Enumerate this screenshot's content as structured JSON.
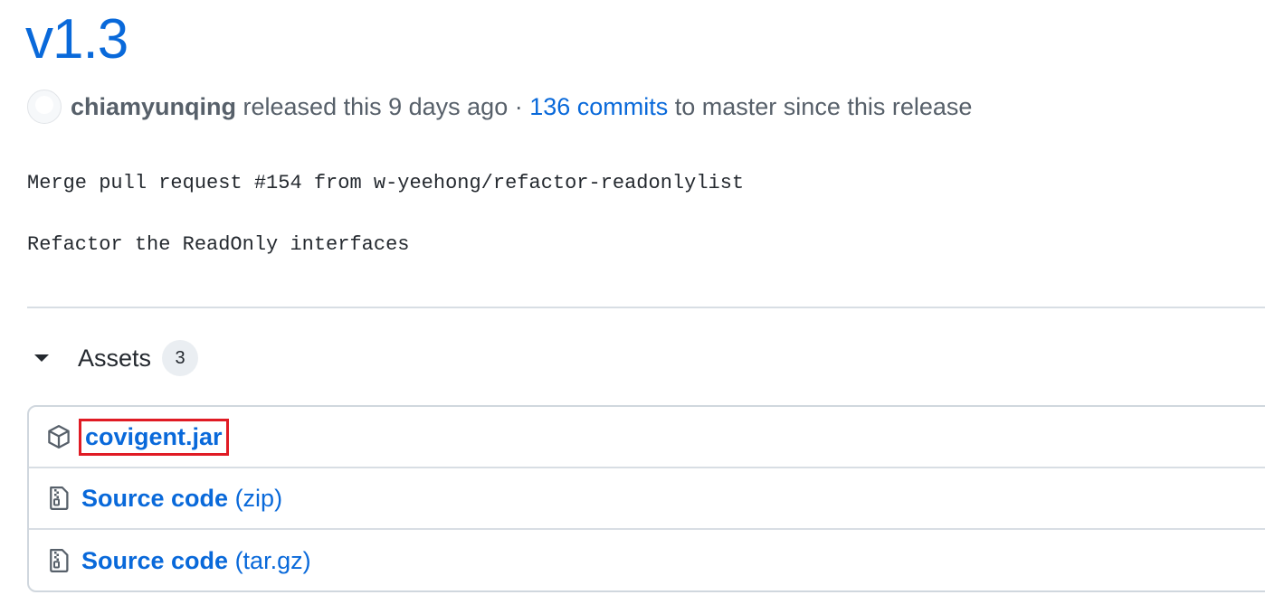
{
  "release": {
    "title": "v1.3",
    "author": "chiamyunqing",
    "released_text": " released this 9 days ago · ",
    "commits_link": "136 commits",
    "commits_suffix": " to master since this release"
  },
  "body": {
    "line1": "Merge pull request #154 from w-yeehong/refactor-readonlylist",
    "line2": "Refactor the ReadOnly interfaces"
  },
  "assets": {
    "label": "Assets",
    "count": "3",
    "items": [
      {
        "name": "covigent.jar",
        "icon": "package-icon"
      },
      {
        "name": "Source code",
        "suffix": " (zip)",
        "icon": "file-zip-icon"
      },
      {
        "name": "Source code",
        "suffix": " (tar.gz)",
        "icon": "file-zip-icon"
      }
    ]
  },
  "colors": {
    "link": "#0969da",
    "highlight": "#e01b24"
  }
}
